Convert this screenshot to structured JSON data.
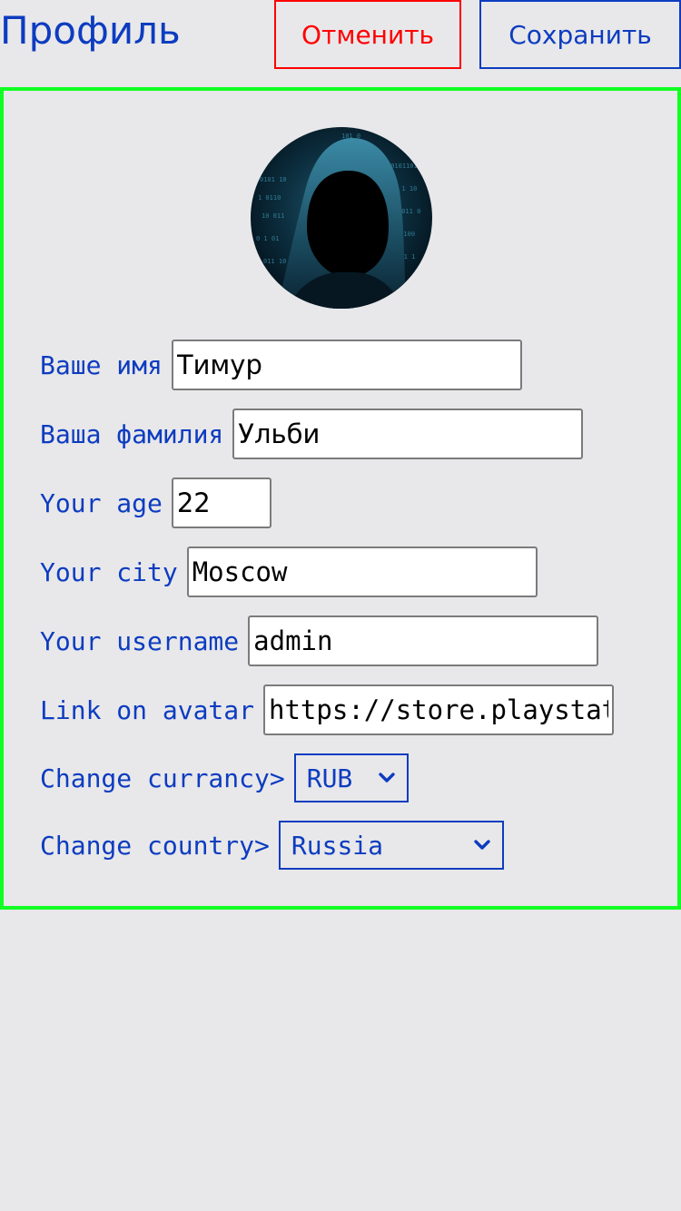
{
  "header": {
    "title": "Профиль",
    "cancel_label": "Отменить",
    "save_label": "Сохранить"
  },
  "avatar": {
    "alt": "hooded figure with binary code"
  },
  "form": {
    "first_name": {
      "label": "Ваше имя",
      "value": "Тимур"
    },
    "last_name": {
      "label": "Ваша фамилия",
      "value": "Ульби"
    },
    "age": {
      "label": "Your age",
      "value": "22"
    },
    "city": {
      "label": "Your city",
      "value": "Moscow"
    },
    "username": {
      "label": "Your username",
      "value": "admin"
    },
    "avatar_link": {
      "label": "Link on avatar",
      "value": "https://store.playstat"
    },
    "currency": {
      "label": "Change currancy>",
      "selected": "RUB"
    },
    "country": {
      "label": "Change country>",
      "selected": "Russia"
    }
  },
  "colors": {
    "accent": "#0d3cc0",
    "cancel": "#ff0000",
    "card_border": "#11ff22",
    "background": "#e8e8ea"
  }
}
